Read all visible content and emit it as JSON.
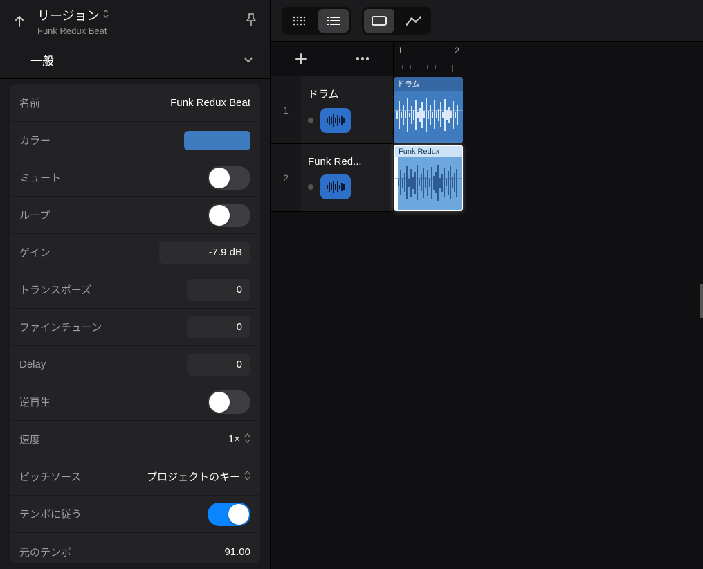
{
  "inspector": {
    "title": "リージョン",
    "subtitle": "Funk Redux Beat",
    "section": "一般",
    "rows": {
      "name_label": "名前",
      "name_value": "Funk Redux Beat",
      "color_label": "カラー",
      "mute_label": "ミュート",
      "loop_label": "ループ",
      "gain_label": "ゲイン",
      "gain_value": "-7.9 dB",
      "transpose_label": "トランスポーズ",
      "transpose_value": "0",
      "finetune_label": "ファインチューン",
      "finetune_value": "0",
      "delay_label": "Delay",
      "delay_value": "0",
      "reverse_label": "逆再生",
      "speed_label": "速度",
      "speed_value": "1×",
      "pitchsource_label": "ピッチソース",
      "pitchsource_value": "プロジェクトのキー",
      "followtempo_label": "テンポに従う",
      "origtempo_label": "元のテンポ",
      "origtempo_value": "91.00"
    }
  },
  "ruler": {
    "pos1": "1",
    "pos2": "2"
  },
  "tracks": [
    {
      "num": "1",
      "name": "ドラム",
      "region_label": "ドラム"
    },
    {
      "num": "2",
      "name": "Funk Red...",
      "region_label": "Funk Redux"
    }
  ]
}
